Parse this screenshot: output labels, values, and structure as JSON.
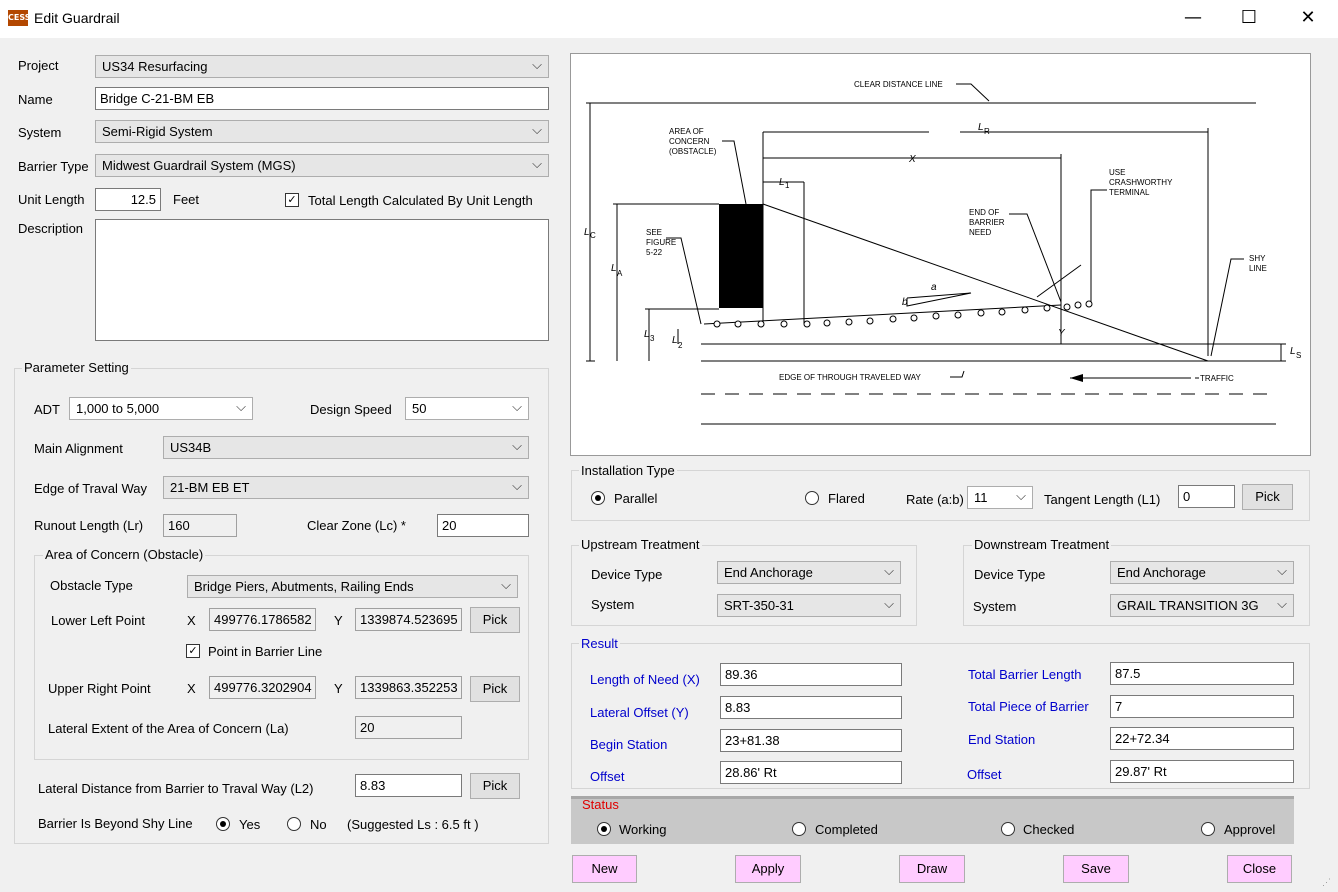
{
  "window": {
    "title": "Edit Guardrail",
    "icon_text": "CESS",
    "minimize": "—",
    "maximize": "☐",
    "close": "✕"
  },
  "form": {
    "project_label": "Project",
    "project_value": "US34 Resurfacing",
    "name_label": "Name",
    "name_value": "Bridge C-21-BM EB",
    "system_label": "System",
    "system_value": "Semi-Rigid System",
    "barrier_type_label": "Barrier Type",
    "barrier_type_value": "Midwest Guardrail System (MGS)",
    "unit_length_label": "Unit Length",
    "unit_length_value": "12.5",
    "unit_length_unit": "Feet",
    "total_length_checkbox_label": "Total Length Calculated By Unit Length",
    "total_length_checked": true,
    "description_label": "Description",
    "description_value": ""
  },
  "parameters": {
    "group_label": "Parameter Setting",
    "adt_label": "ADT",
    "adt_value": "1,000 to 5,000",
    "design_speed_label": "Design Speed",
    "design_speed_value": "50",
    "main_alignment_label": "Main Alignment",
    "main_alignment_value": "US34B",
    "edge_label": "Edge of Traval Way",
    "edge_value": "21-BM EB ET",
    "runout_label": "Runout Length (Lr)",
    "runout_value": "160",
    "clear_zone_label": "Clear Zone (Lc) *",
    "clear_zone_value": "20",
    "area": {
      "group_label": "Area of Concern (Obstacle)",
      "obstacle_type_label": "Obstacle Type",
      "obstacle_type_value": "Bridge Piers, Abutments, Railing Ends",
      "lower_left_label": "Lower Left Point",
      "x_label": "X",
      "y_label": "Y",
      "lower_left_x": "499776.1786582",
      "lower_left_y": "1339874.523695",
      "pick_label": "Pick",
      "point_in_barrier_label": "Point in Barrier Line",
      "point_in_barrier_checked": true,
      "upper_right_label": "Upper Right Point",
      "upper_right_x": "499776.3202904",
      "upper_right_y": "1339863.352253",
      "lateral_extent_label": "Lateral Extent of the Area of Concern (La)",
      "lateral_extent_value": "20"
    },
    "lateral_distance_label": "Lateral Distance from Barrier to Traval Way (L2)",
    "lateral_distance_value": "8.83",
    "beyond_shy_label": "Barrier Is Beyond Shy Line",
    "yes_label": "Yes",
    "no_label": "No",
    "beyond_shy_selected": "Yes",
    "suggested_ls": "(Suggested Ls :   6.5    ft )"
  },
  "diagram": {
    "clear_distance_line": "CLEAR DISTANCE LINE",
    "area_of_concern": [
      "AREA OF",
      "CONCERN",
      "(OBSTACLE)"
    ],
    "see_figure": [
      "SEE",
      "FIGURE",
      "5-22"
    ],
    "use_crashworthy": [
      "USE",
      "CRASHWORTHY",
      "TERMINAL"
    ],
    "end_of_barrier": [
      "END OF",
      "BARRIER",
      "NEED"
    ],
    "shy_line": [
      "SHY",
      "LINE"
    ],
    "edge_of_traveled_way": "EDGE OF THROUGH TRAVELED WAY",
    "traffic": "TRAFFIC",
    "lr": "L",
    "lr_sub": "R",
    "x": "X",
    "l1": "L",
    "l1_sub": "1",
    "lc": "L",
    "lc_sub": "C",
    "la": "L",
    "la_sub": "A",
    "l3": "L",
    "l3_sub": "3",
    "l2": "L",
    "l2_sub": "2",
    "ls": "L",
    "ls_sub": "S",
    "y": "Y",
    "a": "a",
    "b": "b"
  },
  "installation": {
    "group_label": "Installation Type",
    "parallel_label": "Parallel",
    "flared_label": "Flared",
    "selected": "Parallel",
    "rate_label": "Rate (a:b)",
    "rate_value": "11",
    "tangent_label": "Tangent Length (L1)",
    "tangent_value": "0",
    "pick_label": "Pick"
  },
  "upstream": {
    "group_label": "Upstream Treatment",
    "device_type_label": "Device Type",
    "device_type_value": "End Anchorage",
    "system_label": "System",
    "system_value": "SRT-350-31"
  },
  "downstream": {
    "group_label": "Downstream Treatment",
    "device_type_label": "Device Type",
    "device_type_value": "End Anchorage",
    "system_label": "System",
    "system_value": "GRAIL TRANSITION 3G"
  },
  "result": {
    "group_label": "Result",
    "length_of_need_label": "Length of Need (X)",
    "length_of_need_value": "89.36",
    "lateral_offset_label": "Lateral Offset (Y)",
    "lateral_offset_value": "8.83",
    "begin_station_label": "Begin Station",
    "begin_station_value": "23+81.38",
    "offset_label": "Offset",
    "begin_offset_value": "28.86' Rt",
    "total_barrier_length_label": "Total Barrier Length",
    "total_barrier_length_value": "87.5",
    "total_piece_label": "Total Piece of Barrier",
    "total_piece_value": "7",
    "end_station_label": "End Station",
    "end_station_value": "22+72.34",
    "end_offset_value": "29.87' Rt"
  },
  "status": {
    "group_label": "Status",
    "working": "Working",
    "completed": "Completed",
    "checked": "Checked",
    "approved": "Approvel",
    "selected": "Working"
  },
  "buttons": {
    "new": "New",
    "apply": "Apply",
    "draw": "Draw",
    "save": "Save",
    "close": "Close"
  }
}
